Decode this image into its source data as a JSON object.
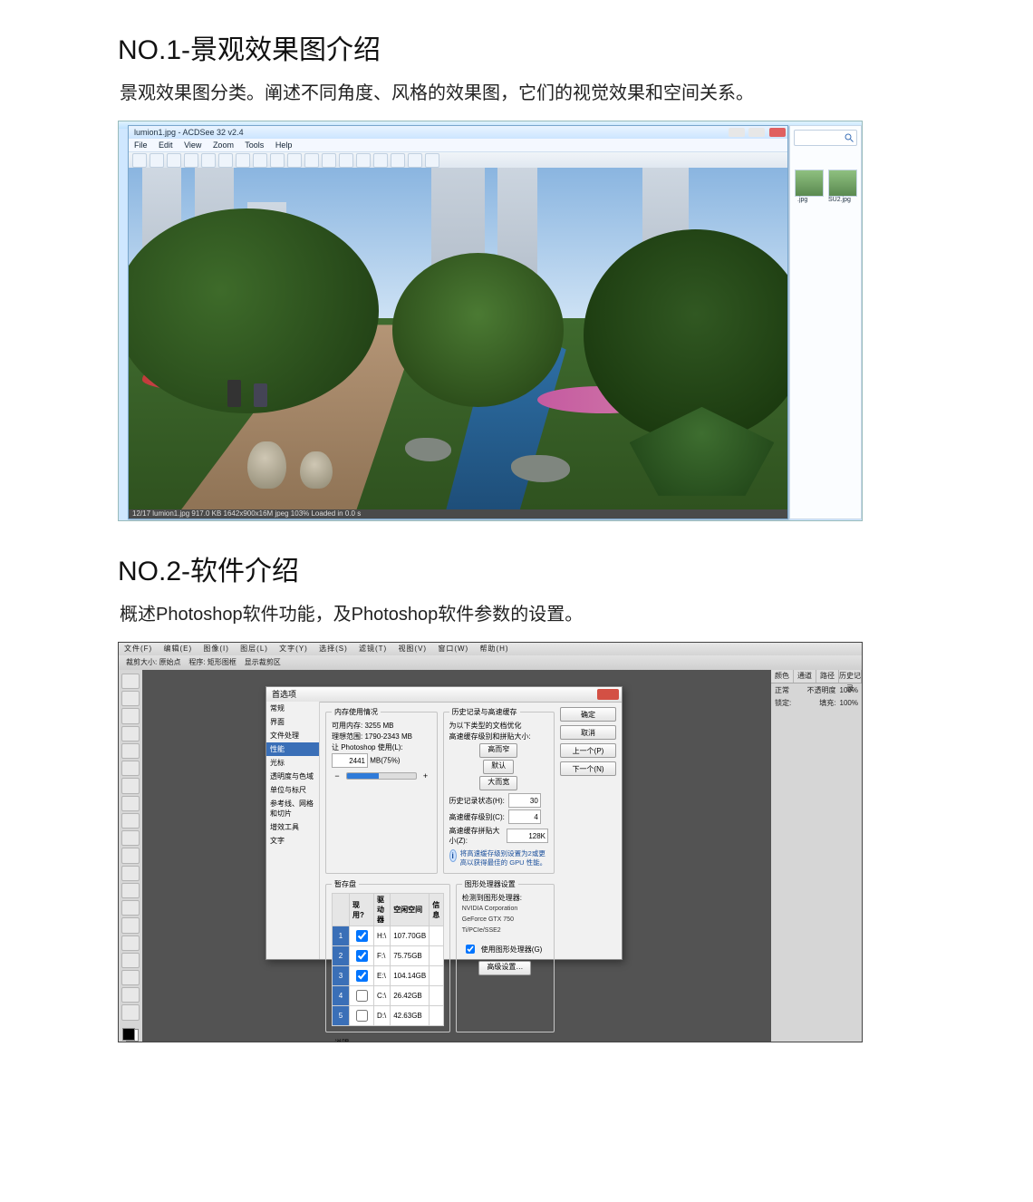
{
  "sections": [
    {
      "title": "NO.1-景观效果图介绍",
      "desc": "景观效果图分类。阐述不同角度、风格的效果图，它们的视觉效果和空间关系。"
    },
    {
      "title": "NO.2-软件介绍",
      "desc": "概述Photoshop软件功能，及Photoshop软件参数的设置。"
    }
  ],
  "acdsee": {
    "title": "lumion1.jpg - ACDSee 32 v2.4",
    "menu": [
      "File",
      "Edit",
      "View",
      "Zoom",
      "Tools",
      "Help"
    ],
    "status": "12/17   lumion1.jpg   917.0 KB   1642x900x16M jpeg   103%   Loaded in 0.0 s"
  },
  "explorer": {
    "thumbs": [
      {
        "label": ".jpg"
      },
      {
        "label": "SU2.jpg"
      }
    ]
  },
  "ps": {
    "menu": [
      "文件(F)",
      "编辑(E)",
      "图像(I)",
      "图层(L)",
      "文字(Y)",
      "选择(S)",
      "滤镜(T)",
      "视图(V)",
      "窗口(W)",
      "帮助(H)"
    ],
    "optbar": {
      "label1": "裁剪大小:",
      "preset": "原始点",
      "label2": "程序:",
      "prog": "矩形图框",
      "show": "显示裁剪区"
    },
    "panels": {
      "row1": [
        "颜色",
        "通道",
        "路径",
        "历史记录"
      ],
      "mode_label": "正常",
      "opacity_label": "不透明度",
      "opacity_val": "100%",
      "lock_label": "锁定:",
      "fill_label": "填充:",
      "fill_val": "100%"
    }
  },
  "dlg": {
    "title": "首选项",
    "side": [
      "常规",
      "界面",
      "文件处理",
      "性能",
      "光标",
      "透明度与色域",
      "单位与标尺",
      "参考线、网格和切片",
      "增效工具",
      "文字"
    ],
    "side_selected": 3,
    "btns": {
      "ok": "确定",
      "cancel": "取消",
      "prev": "上一个(P)",
      "next": "下一个(N)"
    },
    "mem": {
      "legend": "内存使用情况",
      "avail_label": "可用内存:",
      "avail_val": "3255 MB",
      "ideal_label": "理想范围:",
      "ideal_val": "1790-2343 MB",
      "let_label": "让 Photoshop 使用(L):",
      "let_val": "2441",
      "let_pct": "MB(75%)"
    },
    "hist": {
      "legend": "历史记录与高速缓存",
      "hint1": "为以下类型的文档优化",
      "hint2": "高速缓存级别和拼贴大小:",
      "btn_tall": "高而窄",
      "btn_default": "默认",
      "btn_wide": "大而宽",
      "states_label": "历史记录状态(H):",
      "states_val": "30",
      "levels_label": "高速缓存级别(C):",
      "levels_val": "4",
      "tile_label": "高速缓存拼贴大小(Z):",
      "tile_val": "128K",
      "info": "将高速缓存级别设置为2或更高以获得最佳的 GPU 性能。"
    },
    "scratch": {
      "legend": "暂存盘",
      "headers": [
        "现用?",
        "驱动器",
        "空闲空间",
        "信息"
      ],
      "rows": [
        {
          "n": "1",
          "on": true,
          "drv": "H:\\",
          "free": "107.70GB",
          "info": ""
        },
        {
          "n": "2",
          "on": true,
          "drv": "F:\\",
          "free": "75.75GB",
          "info": ""
        },
        {
          "n": "3",
          "on": true,
          "drv": "E:\\",
          "free": "104.14GB",
          "info": ""
        },
        {
          "n": "4",
          "on": false,
          "drv": "C:\\",
          "free": "26.42GB",
          "info": ""
        },
        {
          "n": "5",
          "on": false,
          "drv": "D:\\",
          "free": "42.63GB",
          "info": ""
        }
      ]
    },
    "gpu": {
      "legend": "图形处理器设置",
      "det_label": "检测到图形处理器:",
      "det1": "NVIDIA Corporation",
      "det2": "GeForce GTX 750 Ti/PCIe/SSE2",
      "use_label": "使用图形处理器(G)",
      "adv": "高级设置…"
    },
    "note_legend": "说明"
  }
}
